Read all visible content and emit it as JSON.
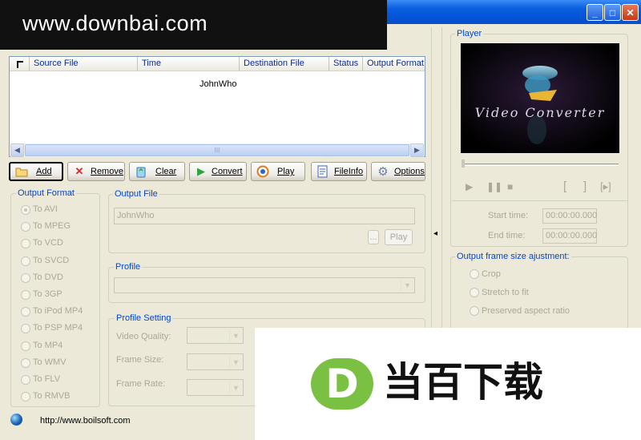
{
  "window": {
    "watermark": "www.downbai.com",
    "controls": {
      "minimize": "_",
      "maximize": "□",
      "close": "✕"
    }
  },
  "filelist": {
    "columns": [
      "Source File",
      "Time",
      "Destination File",
      "Status",
      "Output Format"
    ],
    "rows": [
      {
        "name": "JohnWho"
      }
    ],
    "scroll_thumb": "III"
  },
  "toolbar": {
    "add": "Add",
    "remove": "Remove",
    "clear": "Clear",
    "convert": "Convert",
    "play": "Play",
    "fileinfo": "FileInfo",
    "options": "Options"
  },
  "output_format": {
    "label": "Output Format",
    "options": [
      "To AVI",
      "To MPEG",
      "To VCD",
      "To SVCD",
      "To DVD",
      "To 3GP",
      "To iPod MP4",
      "To PSP MP4",
      "To MP4",
      "To WMV",
      "To FLV",
      "To RMVB"
    ],
    "selected": "To AVI"
  },
  "output_file": {
    "label": "Output File",
    "value": "JohnWho",
    "browse": "...",
    "play": "Play"
  },
  "profile": {
    "label": "Profile"
  },
  "profile_setting": {
    "label": "Profile Setting",
    "video_quality": "Video Quality:",
    "frame_size": "Frame Size:",
    "frame_rate": "Frame Rate:"
  },
  "player": {
    "label": "Player",
    "video_title": "Video Converter",
    "start_label": "Start time:",
    "start_time": "00:00:00.000",
    "end_label": "End  time:",
    "end_time": "00:00:00.000",
    "mark_in": "[",
    "mark_out": "]",
    "mark_play": "[▸]",
    "collapse_arrow": "◂"
  },
  "frame_adjust": {
    "label": "Output frame size ajustment:",
    "options": [
      "Crop",
      "Stretch to fit",
      "Preserved aspect ratio"
    ]
  },
  "status": {
    "url": "http://www.boilsoft.com"
  },
  "overlay": {
    "brand": "当百下载",
    "letter": "D"
  },
  "colors": {
    "accent": "#0046D5",
    "brand_green": "#7AC143",
    "titlebar": "#0454D8"
  }
}
